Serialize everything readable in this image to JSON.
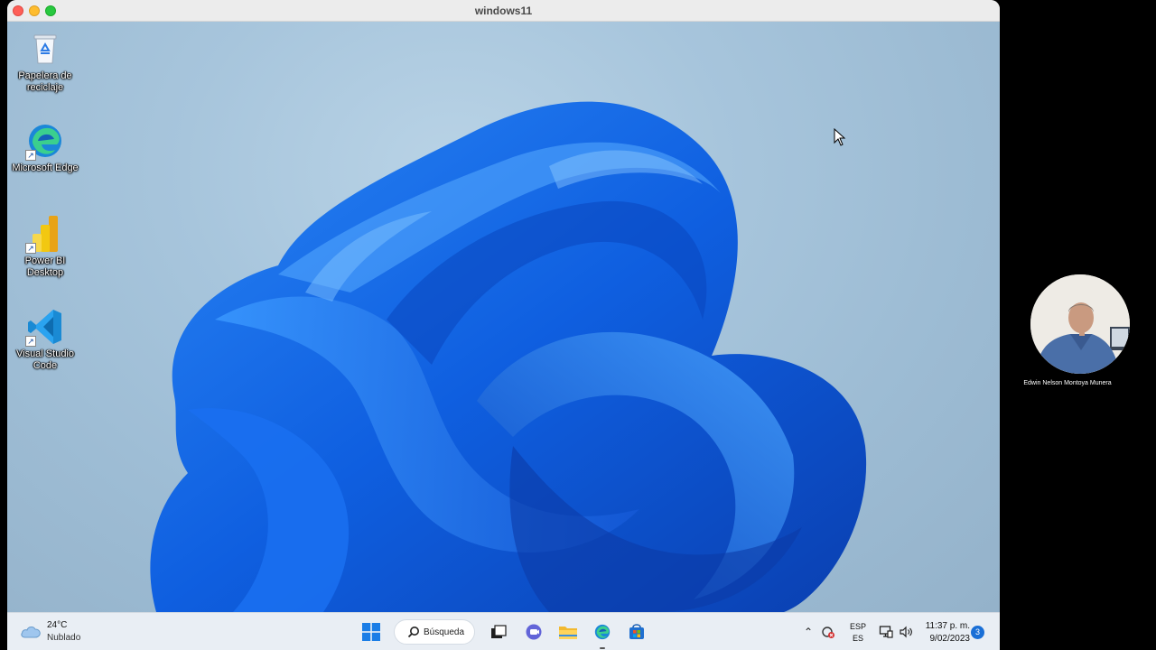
{
  "window": {
    "title": "windows11"
  },
  "desktop_icons": [
    {
      "label": "Papelera de reciclaje",
      "icon": "recycle-bin-icon"
    },
    {
      "label": "Microsoft Edge",
      "icon": "edge-icon"
    },
    {
      "label": "Power BI Desktop",
      "icon": "power-bi-icon"
    },
    {
      "label": "Visual Studio Code",
      "icon": "vscode-icon"
    }
  ],
  "taskbar": {
    "weather": {
      "temperature": "24°C",
      "condition": "Nublado",
      "icon": "cloud-icon"
    },
    "search_label": "Búsqueda",
    "pinned": [
      "start-icon",
      "search-icon",
      "task-view-icon",
      "teams-chat-icon",
      "file-explorer-icon",
      "edge-icon",
      "store-icon"
    ],
    "tray": {
      "language_top": "ESP",
      "language_bottom": "ES",
      "time": "11:37 p. m.",
      "date": "9/02/2023",
      "notification_count": "3"
    }
  },
  "presenter": {
    "name": "Edwin Nelson Montoya Munera"
  },
  "colors": {
    "accent": "#1a6fd6",
    "bloom": "#1565e0",
    "desktop_bg": "#a7c5dc",
    "taskbar_bg": "#e9eef4"
  }
}
